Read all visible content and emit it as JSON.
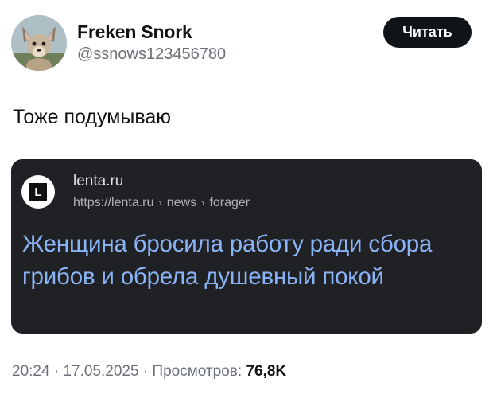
{
  "author": {
    "name": "Freken Snork",
    "handle": "@ssnows123456780"
  },
  "follow_button": {
    "label": "Читать"
  },
  "tweet": {
    "text": "Тоже подумываю"
  },
  "link_card": {
    "logo_letter": "L",
    "site_name": "lenta.ru",
    "url_parts": [
      "https://lenta.ru",
      "news",
      "forager"
    ],
    "url_separator": "›",
    "headline": "Женщина бросила работу ради сбора грибов и обрела душевный покой",
    "colors": {
      "background": "#202124",
      "headline": "#8ab4f8"
    }
  },
  "meta": {
    "time": "20:24",
    "date": "17.05.2025",
    "views_label": "Просмотров:",
    "views_count": "76,8K",
    "dot": "·"
  }
}
